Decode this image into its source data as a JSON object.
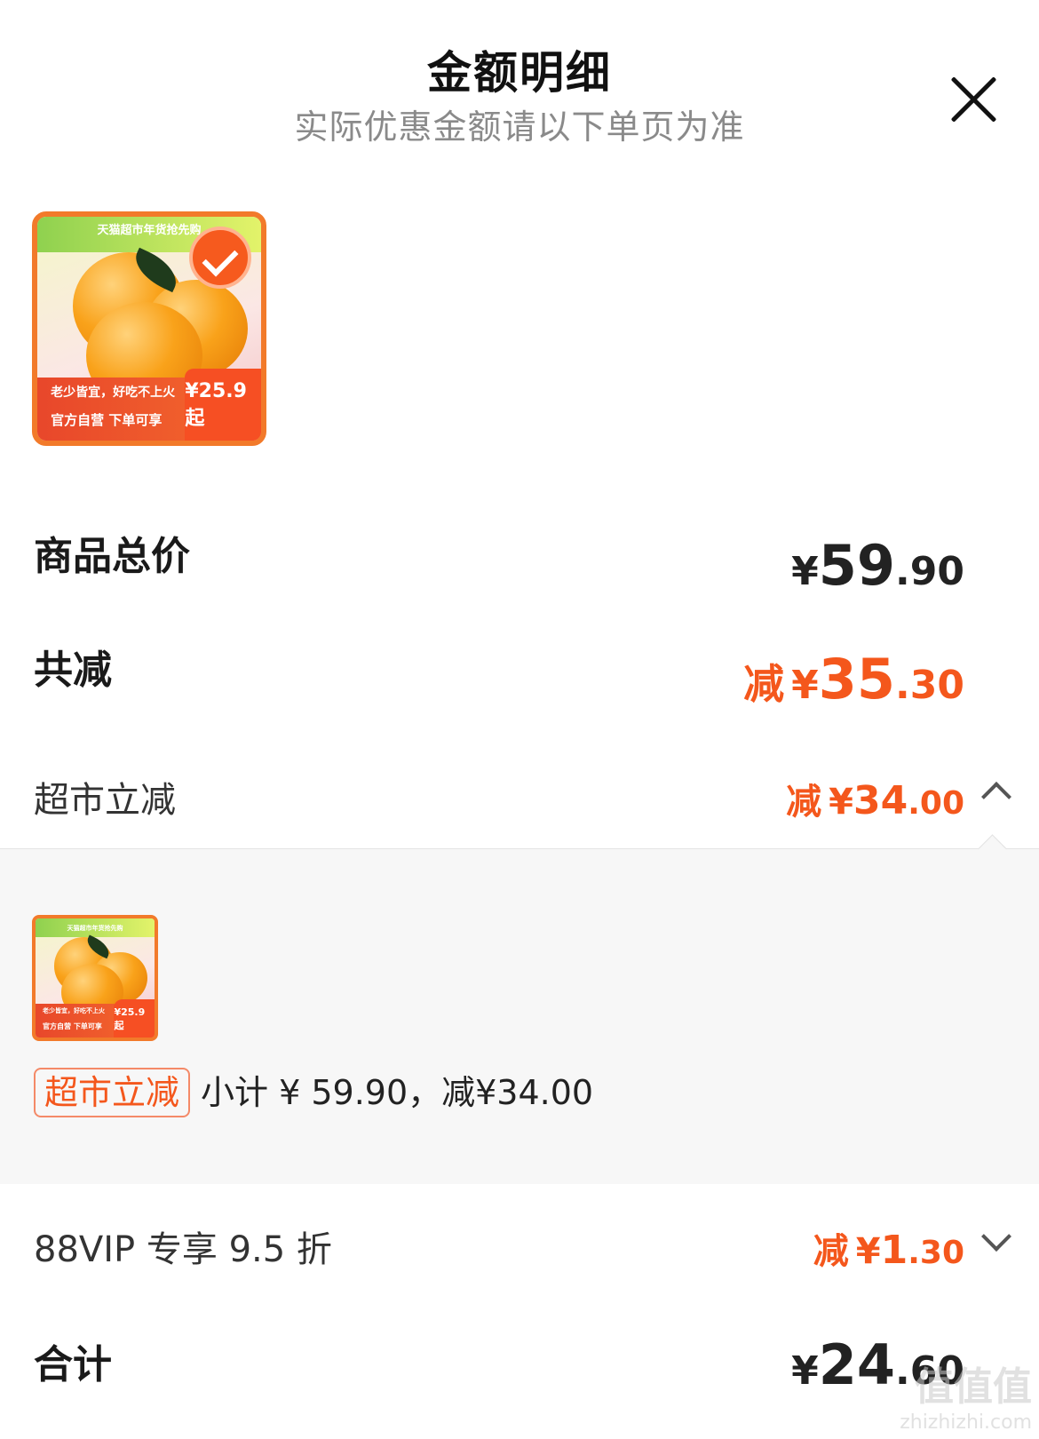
{
  "header": {
    "title": "金额明细",
    "subtitle": "实际优惠金额请以下单页为准"
  },
  "product_image": {
    "banner": "天猫超市年货抢先购",
    "line1": "老少皆宜，好吃不上火",
    "line2": "官方自营 下单可享",
    "price_tag": "¥25.9起",
    "selected": true
  },
  "summary": {
    "total_label": "商品总价",
    "total": {
      "currency": "¥",
      "int": "59",
      "dec": ".90"
    },
    "discount_label": "共减",
    "discount": {
      "prefix": "减",
      "currency": "¥",
      "int": "35",
      "dec": ".30"
    }
  },
  "discounts": [
    {
      "label": "超市立减",
      "amount": {
        "prefix": "减",
        "currency": "¥",
        "int": "34",
        "dec": ".00"
      },
      "expanded": true,
      "detail": {
        "tag": "超市立减",
        "text": "小计 ¥ 59.90，减¥34.00"
      }
    },
    {
      "label": "88VIP 专享 9.5 折",
      "amount": {
        "prefix": "减",
        "currency": "¥",
        "int": "1",
        "dec": ".30"
      },
      "expanded": false
    }
  ],
  "grand_total": {
    "label": "合计",
    "amount": {
      "currency": "¥",
      "int": "24",
      "dec": ".60"
    }
  },
  "watermark": {
    "main": "值值值",
    "sub": "zhizhizhi.com"
  },
  "colors": {
    "accent": "#f4571c",
    "text": "#1a1a1a",
    "muted": "#8a8a8a",
    "panel": "#f7f7f7"
  }
}
